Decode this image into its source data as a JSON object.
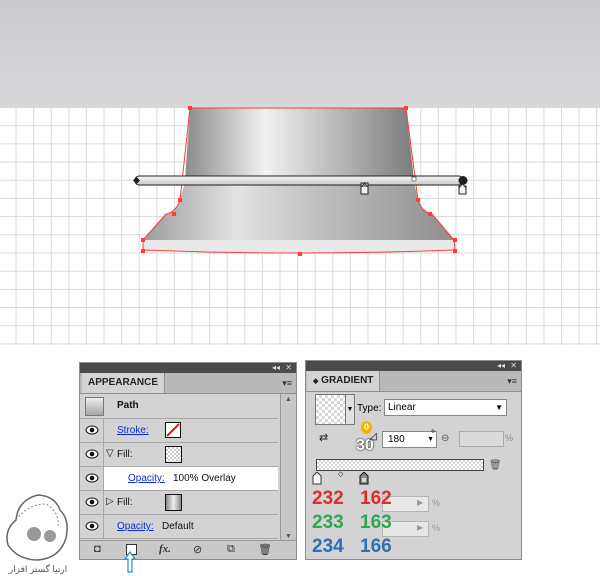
{
  "appearance": {
    "tab_label": "APPEARANCE",
    "header_label": "Path",
    "rows": [
      {
        "label": "Stroke:",
        "kind": "stroke"
      },
      {
        "label": "Fill:",
        "kind": "fill"
      },
      {
        "label": "Opacity:",
        "value": "100% Overlay",
        "kind": "opacity"
      },
      {
        "label": "Fill:",
        "kind": "fill"
      },
      {
        "label": "Opacity:",
        "value": "Default",
        "kind": "opacity"
      }
    ]
  },
  "gradient": {
    "tab_label": "GRADIENT",
    "type_label": "Type:",
    "type_value": "Linear",
    "angle_value": "180",
    "angle_unit": "°",
    "location_unit": "%",
    "opacity_unit": "%",
    "stop_badge_top": "0",
    "stop_badge_bottom": "30"
  },
  "color_values": {
    "red": [
      "232",
      "162"
    ],
    "green": [
      "233",
      "163"
    ],
    "blue": [
      "234",
      "166"
    ],
    "colors": {
      "red": "#e02a2f",
      "green": "#2ea84a",
      "blue": "#2f6fb0"
    }
  },
  "watermark": {
    "caption": "ارتیا گستر افزار"
  }
}
